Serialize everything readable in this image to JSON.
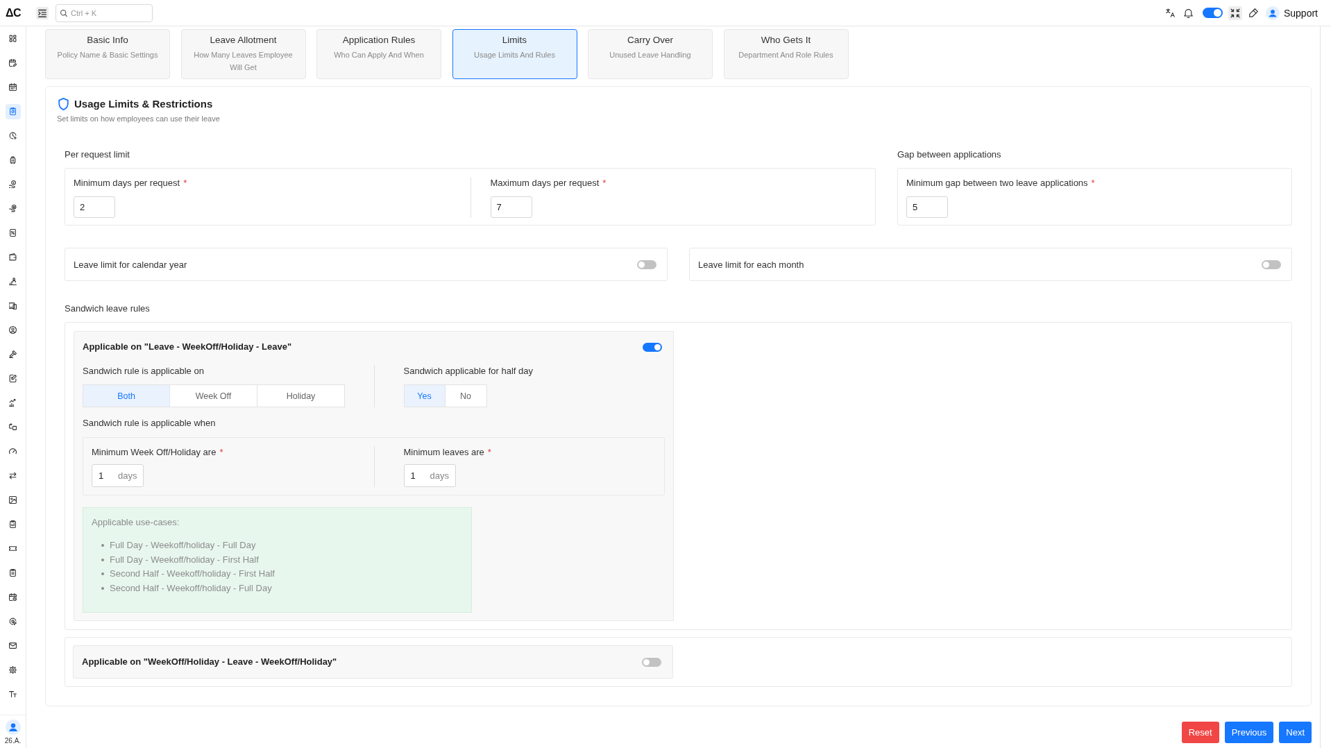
{
  "topbar": {
    "logo": "ΔC",
    "search": {
      "placeholder": "Ctrl + K"
    },
    "theme_toggle": {
      "on": true
    },
    "user": {
      "name": "Support"
    }
  },
  "sidebar": {
    "items": [
      {
        "selected": false
      },
      {
        "selected": false
      },
      {
        "selected": false
      },
      {
        "selected": true
      },
      {
        "selected": false
      },
      {
        "selected": false
      },
      {
        "selected": false
      },
      {
        "selected": false
      },
      {
        "selected": false
      },
      {
        "selected": false
      },
      {
        "selected": false
      },
      {
        "selected": false
      },
      {
        "selected": false
      },
      {
        "selected": false
      },
      {
        "selected": false
      },
      {
        "selected": false
      },
      {
        "selected": false
      },
      {
        "selected": false
      },
      {
        "selected": false
      },
      {
        "selected": false
      },
      {
        "selected": false
      },
      {
        "selected": false
      },
      {
        "selected": false
      },
      {
        "selected": false
      },
      {
        "selected": false
      },
      {
        "selected": false
      },
      {
        "selected": false
      },
      {
        "selected": false
      }
    ],
    "user": {
      "label": "26.A."
    }
  },
  "tabs": [
    {
      "title": "Basic Info",
      "subtitle": "Policy Name & Basic Settings",
      "selected": false
    },
    {
      "title": "Leave Allotment",
      "subtitle": "How Many Leaves Employee Will Get",
      "selected": false
    },
    {
      "title": "Application Rules",
      "subtitle": "Who Can Apply And When",
      "selected": false
    },
    {
      "title": "Limits",
      "subtitle": "Usage Limits And Rules",
      "selected": true
    },
    {
      "title": "Carry Over",
      "subtitle": "Unused Leave Handling",
      "selected": false
    },
    {
      "title": "Who Gets It",
      "subtitle": "Department And Role Rules",
      "selected": false
    }
  ],
  "section": {
    "title": "Usage Limits & Restrictions",
    "subtitle": "Set limits on how employees can use their leave",
    "per_request": {
      "label": "Per request limit",
      "fields": [
        {
          "label": "Minimum days per request",
          "required_mark": "*",
          "value": "2"
        },
        {
          "label": "Maximum days per request",
          "required_mark": "*",
          "value": "7"
        }
      ]
    },
    "gap": {
      "label": "Gap between applications",
      "fields": [
        {
          "label": "Minimum gap between two leave applications",
          "required_mark": "*",
          "value": "5"
        }
      ]
    },
    "limit_toggles": [
      {
        "label": "Leave limit for calendar year",
        "on": false
      },
      {
        "label": "Leave limit for each month",
        "on": false
      }
    ],
    "sandwich": {
      "label": "Sandwich leave rules",
      "rules": [
        {
          "title": "Applicable on \"Leave - WeekOff/Holiday - Leave\"",
          "on": true,
          "applicable_on": {
            "label": "Sandwich rule is applicable on",
            "options": [
              {
                "label": "Both",
                "selected": true
              },
              {
                "label": "Week Off",
                "selected": false
              },
              {
                "label": "Holiday",
                "selected": false
              }
            ]
          },
          "half_day": {
            "label": "Sandwich applicable for half day",
            "options": [
              {
                "label": "Yes",
                "selected": true
              },
              {
                "label": "No",
                "selected": false
              }
            ]
          },
          "conditions": {
            "label": "Sandwich rule is applicable when",
            "fields": [
              {
                "label": "Minimum Week Off/Holiday are",
                "required_mark": "*",
                "value": "1",
                "unit": "days"
              },
              {
                "label": "Minimum leaves are",
                "required_mark": "*",
                "value": "1",
                "unit": "days"
              }
            ]
          },
          "use_cases": {
            "title": "Applicable use-cases:",
            "items": [
              "Full Day - Weekoff/holiday - Full Day",
              "Full Day - Weekoff/holiday - First Half",
              "Second Half - Weekoff/holiday - First Half",
              "Second Half - Weekoff/holiday - Full Day"
            ]
          }
        },
        {
          "title": "Applicable on \"WeekOff/Holiday - Leave - WeekOff/Holiday\"",
          "on": false
        }
      ]
    }
  },
  "buttons": [
    {
      "label": "Reset",
      "kind": "danger"
    },
    {
      "label": "Previous",
      "kind": "primary"
    },
    {
      "label": "Next",
      "kind": "primary"
    }
  ]
}
